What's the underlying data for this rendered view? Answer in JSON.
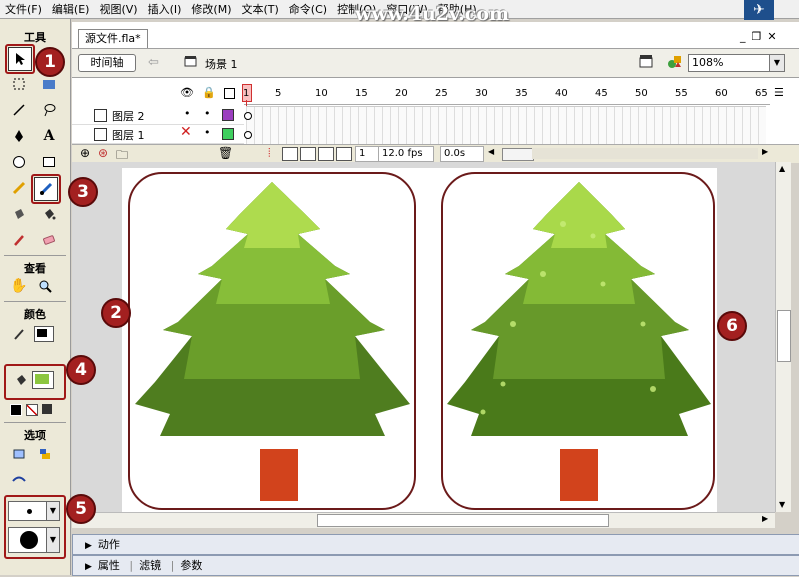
{
  "menu": [
    "文件(F)",
    "编辑(E)",
    "视图(V)",
    "插入(I)",
    "修改(M)",
    "文本(T)",
    "命令(C)",
    "控制(O)",
    "窗口(W)",
    "帮助(H)"
  ],
  "watermark": "www.4u2v.com",
  "tools": {
    "title": "工具",
    "view_title": "查看",
    "color_title": "颜色",
    "options_title": "选项",
    "stroke_color": "#000000",
    "fill_color": "#8cc63f"
  },
  "badges": [
    "1",
    "2",
    "3",
    "4",
    "5",
    "6"
  ],
  "document": {
    "tab_title": "源文件.fla*",
    "timeline_button": "时间轴",
    "scene_label": "场景 1",
    "zoom": "108%"
  },
  "timeline": {
    "frame_numbers": [
      "1",
      "5",
      "10",
      "15",
      "20",
      "25",
      "30",
      "35",
      "40",
      "45",
      "50",
      "55",
      "60",
      "65"
    ],
    "layers": [
      {
        "name": "图层 2",
        "color": "#9b3fbf"
      },
      {
        "name": "图层 1",
        "color": "#3fcf5f"
      }
    ],
    "current_frame": "1",
    "fps": "12.0 fps",
    "time": "0.0s"
  },
  "panels": {
    "actions": "动作",
    "properties": "属性",
    "filters": "滤镜",
    "parameters": "参数"
  },
  "colors": {
    "frame_border": "#6b1a1a",
    "badge": "#a32020",
    "tree_light": "#a9d94a",
    "tree_mid": "#7fb630",
    "tree_dark": "#4f7d1f",
    "trunk": "#d2431c"
  }
}
